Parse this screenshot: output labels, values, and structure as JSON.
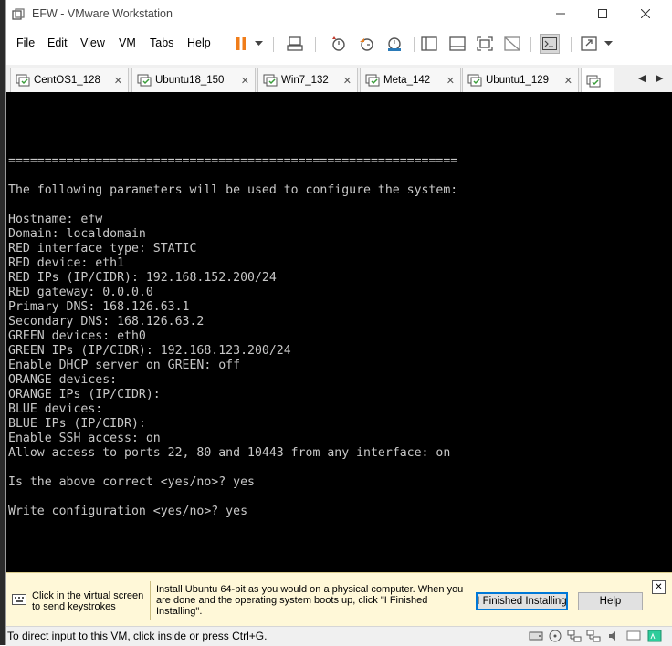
{
  "window": {
    "title": "EFW - VMware Workstation"
  },
  "menu": [
    "File",
    "Edit",
    "View",
    "VM",
    "Tabs",
    "Help"
  ],
  "tabs": [
    {
      "label": "CentOS1_128"
    },
    {
      "label": "Ubuntu18_150"
    },
    {
      "label": "Win7_132"
    },
    {
      "label": "Meta_142"
    },
    {
      "label": "Ubuntu1_129"
    }
  ],
  "console": {
    "lines": [
      "==============================================================",
      "",
      "The following parameters will be used to configure the system:",
      "",
      "Hostname: efw",
      "Domain: localdomain",
      "RED interface type: STATIC",
      "RED device: eth1",
      "RED IPs (IP/CIDR): 192.168.152.200/24",
      "RED gateway: 0.0.0.0",
      "Primary DNS: 168.126.63.1",
      "Secondary DNS: 168.126.63.2",
      "GREEN devices: eth0",
      "GREEN IPs (IP/CIDR): 192.168.123.200/24",
      "Enable DHCP server on GREEN: off",
      "ORANGE devices:",
      "ORANGE IPs (IP/CIDR):",
      "BLUE devices:",
      "BLUE IPs (IP/CIDR):",
      "Enable SSH access: on",
      "Allow access to ports 22, 80 and 10443 from any interface: on",
      "",
      "Is the above correct <yes/no>? yes",
      "",
      "Write configuration <yes/no>? yes"
    ]
  },
  "hint": {
    "left_line1": "Click in the virtual screen",
    "left_line2": "to send keystrokes",
    "msg_line1": "Install Ubuntu 64-bit as you would on a physical computer. When you",
    "msg_line2": "are done and the operating system boots up, click \"I Finished",
    "msg_line3": "Installing\".",
    "finished_label": "I Finished Installing",
    "help_label": "Help"
  },
  "status": {
    "text": "To direct input to this VM, click inside or press Ctrl+G."
  },
  "colors": {
    "console_bg": "#000000",
    "console_fg": "#c8c8c8",
    "pause_orange": "#f07d1a",
    "hint_bg": "#fff8d8"
  }
}
